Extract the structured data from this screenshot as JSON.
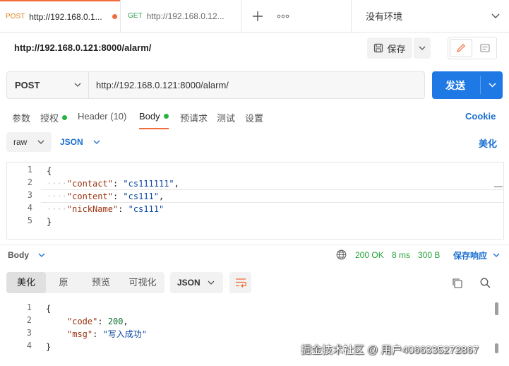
{
  "tabs": [
    {
      "method": "POST",
      "url": "http://192.168.0.1..."
    },
    {
      "method": "GET",
      "url": "http://192.168.0.12..."
    }
  ],
  "environment": "没有环境",
  "request": {
    "title": "http://192.168.0.121:8000/alarm/",
    "save_label": "保存",
    "method": "POST",
    "url": "http://192.168.0.121:8000/alarm/",
    "send_label": "发送"
  },
  "subtabs": {
    "params": "参数",
    "auth": "授权",
    "headers": "Header (10)",
    "body": "Body",
    "prerequest": "预请求",
    "tests": "测试",
    "settings": "设置",
    "cookie": "Cookie"
  },
  "body_options": {
    "mode": "raw",
    "format": "JSON",
    "beautify": "美化"
  },
  "request_body": {
    "line_numbers": [
      "1",
      "2",
      "3",
      "4",
      "5"
    ],
    "lines": [
      "{",
      "\"contact\": \"cs111111\",",
      "\"content\": \"cs111\",",
      "\"nickName\": \"cs111\"",
      "}"
    ]
  },
  "response": {
    "label": "Body",
    "status": "200 OK",
    "time": "8 ms",
    "size": "300 B",
    "save_label": "保存响应",
    "view_tabs": [
      "美化",
      "原",
      "预览",
      "可视化"
    ],
    "format": "JSON",
    "line_numbers": [
      "1",
      "2",
      "3",
      "4"
    ],
    "lines": [
      "{",
      "\"code\": 200,",
      "\"msg\": \"写入成功\"",
      "}"
    ]
  },
  "watermark": "掘金技术社区 @ 用户4066335272867",
  "colors": {
    "accent": "#f26b3a",
    "send": "#1e79e5",
    "status_ok": "#26b340",
    "link": "#1a6fd1"
  }
}
